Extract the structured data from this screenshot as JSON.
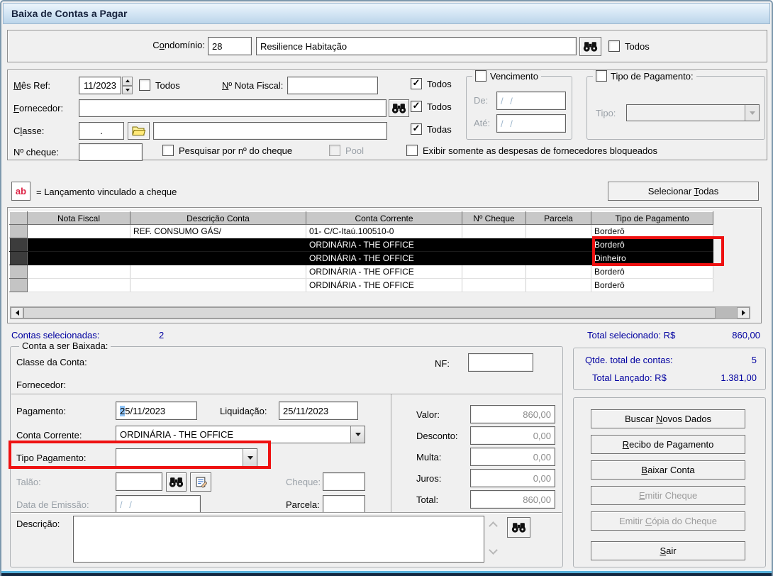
{
  "window": {
    "title": "Baixa de Contas a Pagar"
  },
  "colors": {
    "accent_navy": "#0000a0",
    "annotation_red": "#ee1111",
    "selected_row_bg": "#000000",
    "ab_red": "#dd2244"
  },
  "condominio": {
    "label": {
      "pre": "C",
      "key": "o",
      "post": "ndomínio:"
    },
    "code": "28",
    "name": "Resilience Habitação",
    "todos_label": "Todos"
  },
  "filters": {
    "mes_ref": {
      "label": {
        "pre": "",
        "key": "M",
        "post": "ês Ref:"
      },
      "value": "11/2023",
      "todos_label": "Todos"
    },
    "nota_fiscal": {
      "label": {
        "pre": "",
        "key": "N",
        "post": "º Nota Fiscal:"
      },
      "value": "",
      "todos_label": "Todos"
    },
    "fornecedor": {
      "label": {
        "pre": "",
        "key": "F",
        "post": "ornecedor:"
      },
      "value": "",
      "todos_label": "Todos"
    },
    "classe": {
      "label": {
        "pre": "C",
        "key": "l",
        "post": "asse:"
      },
      "code": ".",
      "name": "",
      "todas_label": "Todas"
    },
    "cheque": {
      "label": "Nº cheque:",
      "value": "",
      "pesquisar_label": "Pesquisar por nº do cheque",
      "pool_label": "Pool"
    },
    "vencimento": {
      "label": "Vencimento",
      "de_label": "De:",
      "de_value": "/ /",
      "ate_label": "Até:",
      "ate_value": "/ /"
    },
    "tipo_pagamento_group": {
      "label": "Tipo de Pagamento:",
      "tipo_label": "Tipo:",
      "tipo_value": ""
    },
    "exibir_bloqueados_label": "Exibir somente as despesas de fornecedores bloqueados"
  },
  "legend": {
    "ab": "ab",
    "text": "= Lançamento vinculado a cheque"
  },
  "selecionar_todas": {
    "pre": "Selecionar ",
    "key": "T",
    "post": "odas"
  },
  "table": {
    "columns": [
      "Nota Fiscal",
      "Descrição Conta",
      "Conta Corrente",
      "Nº Cheque",
      "Parcela",
      "Tipo de Pagamento"
    ],
    "rows": [
      {
        "nota_fiscal": "",
        "descricao": "REF. CONSUMO GÁS/",
        "conta_corrente": "01- C/C-Itaú.100510-0",
        "n_cheque": "",
        "parcela": "",
        "tipo": "Borderô",
        "selected": false
      },
      {
        "nota_fiscal": "",
        "descricao": "",
        "conta_corrente": "ORDINÁRIA - THE OFFICE",
        "n_cheque": "",
        "parcela": "",
        "tipo": "Borderô",
        "selected": true
      },
      {
        "nota_fiscal": "",
        "descricao": "",
        "conta_corrente": "ORDINÁRIA - THE OFFICE",
        "n_cheque": "",
        "parcela": "",
        "tipo": "Dinheiro",
        "selected": true
      },
      {
        "nota_fiscal": "",
        "descricao": "",
        "conta_corrente": "ORDINÁRIA - THE OFFICE",
        "n_cheque": "",
        "parcela": "",
        "tipo": "Borderô",
        "selected": false
      },
      {
        "nota_fiscal": "",
        "descricao": "",
        "conta_corrente": "ORDINÁRIA - THE OFFICE",
        "n_cheque": "",
        "parcela": "",
        "tipo": "Borderô",
        "selected": false
      }
    ]
  },
  "stats": {
    "contas_selecionadas_label": "Contas selecionadas:",
    "contas_selecionadas_value": "2",
    "total_selecionado_label": "Total selecionado: R$",
    "total_selecionado_value": "860,00",
    "qtde_label": "Qtde. total de contas:",
    "qtde_value": "5",
    "total_lancado_label": "Total Lançado: R$",
    "total_lancado_value": "1.381,00"
  },
  "baixada": {
    "group_label": "Conta a ser Baixada:",
    "classe_label": "Classe da Conta:",
    "nf_label": "NF:",
    "nf_value": "",
    "fornecedor_label": "Fornecedor:",
    "pagamento_label": "Pagamento:",
    "pagamento_sel": "2",
    "pagamento_rest": "5/11/2023",
    "liquidacao_label": "Liquidação:",
    "liquidacao_value": "25/11/2023",
    "conta_corrente_label": "Conta Corrente:",
    "conta_corrente_value": "ORDINÁRIA - THE OFFICE",
    "tipo_pagamento_label": "Tipo Pagamento:",
    "tipo_pagamento_value": "",
    "talao_label": "Talão:",
    "talao_value": "",
    "cheque_label": "Cheque:",
    "cheque_value": "",
    "emissao_label": "Data de Emissão:",
    "emissao_value": "/ /",
    "parcela_label": "Parcela:",
    "parcela_value": "",
    "descricao_label": "Descrição:",
    "descricao_value": "",
    "valores": {
      "valor_label": "Valor:",
      "valor": "860,00",
      "desconto_label": "Desconto:",
      "desconto": "0,00",
      "multa_label": "Multa:",
      "multa": "0,00",
      "juros_label": "Juros:",
      "juros": "0,00",
      "total_label": "Total:",
      "total": "860,00"
    }
  },
  "buttons": {
    "buscar": {
      "pre": "Buscar ",
      "key": "N",
      "post": "ovos Dados"
    },
    "recibo": {
      "pre": "",
      "key": "R",
      "post": "ecibo de Pagamento"
    },
    "baixar": {
      "pre": "",
      "key": "B",
      "post": "aixar Conta"
    },
    "emitir_cheque": {
      "pre": "",
      "key": "E",
      "post": "mitir Cheque"
    },
    "emitir_copia": {
      "pre": "Emitir ",
      "key": "C",
      "post": "ópia do Cheque"
    },
    "sair": {
      "pre": "",
      "key": "S",
      "post": "air"
    }
  }
}
